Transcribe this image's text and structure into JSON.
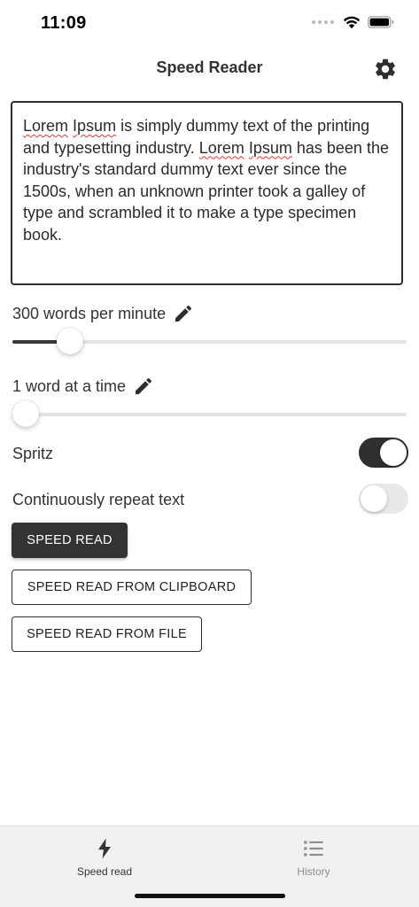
{
  "status_bar": {
    "time": "11:09",
    "icons": [
      "cellular-dots-icon",
      "wifi-icon",
      "battery-icon"
    ]
  },
  "header": {
    "title": "Speed Reader",
    "settings_icon": "gear-icon"
  },
  "text_input": {
    "misspelled_1": "Lorem",
    "misspelled_2": "Ipsum",
    "segment_1": " is simply dummy text of the printing and typesetting industry. ",
    "misspelled_3": "Lorem",
    "misspelled_4": "Ipsum",
    "segment_2": " has been the industry's standard dummy text ever since the 1500s, when an unknown printer took a galley of type and scrambled it to make a type specimen book."
  },
  "speed": {
    "label": "300 words per minute",
    "edit_icon": "pencil-icon",
    "slider_fraction": 0.12
  },
  "chunk": {
    "label": "1 word at a time",
    "edit_icon": "pencil-icon",
    "slider_fraction": 0.0
  },
  "spritz": {
    "label": "Spritz",
    "enabled": true
  },
  "repeat": {
    "label": "Continuously repeat text",
    "enabled": false
  },
  "buttons": {
    "speed_read": "SPEED READ",
    "from_clipboard": "SPEED READ FROM CLIPBOARD",
    "from_file": "SPEED READ FROM FILE"
  },
  "bottom_nav": {
    "items": [
      {
        "label": "Speed read",
        "icon": "lightning-bolt-icon",
        "active": true
      },
      {
        "label": "History",
        "icon": "list-icon",
        "active": false
      }
    ]
  },
  "colors": {
    "accent_dark": "#333333",
    "track": "#e4e4e4",
    "nav_background": "#f1f1f1",
    "spellcheck_underline": "#e53935"
  }
}
